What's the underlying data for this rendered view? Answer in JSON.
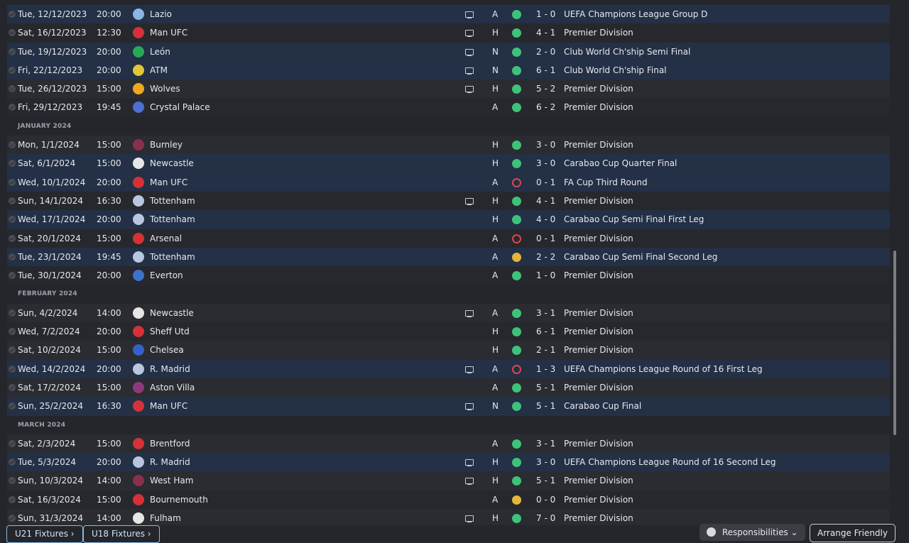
{
  "fixtures": [
    {
      "type": "fixture",
      "date": "Tue, 12/12/2023",
      "time": "20:00",
      "team": "Lazio",
      "tv": true,
      "venue": "A",
      "result": "W",
      "score": "1 - 0",
      "competition": "UEFA Champions League Group D",
      "cup": true,
      "badge_color": "#8ab6e6"
    },
    {
      "type": "fixture",
      "date": "Sat, 16/12/2023",
      "time": "12:30",
      "team": "Man UFC",
      "tv": true,
      "venue": "H",
      "result": "W",
      "score": "4 - 1",
      "competition": "Premier Division",
      "cup": false,
      "badge_color": "#d63139"
    },
    {
      "type": "fixture",
      "date": "Tue, 19/12/2023",
      "time": "20:00",
      "team": "León",
      "tv": true,
      "venue": "N",
      "result": "W",
      "score": "2 - 0",
      "competition": "Club World Ch'ship Semi Final",
      "cup": true,
      "badge_color": "#2aa85a"
    },
    {
      "type": "fixture",
      "date": "Fri, 22/12/2023",
      "time": "20:00",
      "team": "ATM",
      "tv": true,
      "venue": "N",
      "result": "W",
      "score": "6 - 1",
      "competition": "Club World Ch'ship Final",
      "cup": true,
      "badge_color": "#e3c53a"
    },
    {
      "type": "fixture",
      "date": "Tue, 26/12/2023",
      "time": "15:00",
      "team": "Wolves",
      "tv": true,
      "venue": "H",
      "result": "W",
      "score": "5 - 2",
      "competition": "Premier Division",
      "cup": false,
      "badge_color": "#f0a81f"
    },
    {
      "type": "fixture",
      "date": "Fri, 29/12/2023",
      "time": "19:45",
      "team": "Crystal Palace",
      "tv": false,
      "venue": "A",
      "result": "W",
      "score": "6 - 2",
      "competition": "Premier Division",
      "cup": false,
      "badge_color": "#4c6fd1"
    },
    {
      "type": "header",
      "label": "JANUARY 2024"
    },
    {
      "type": "fixture",
      "date": "Mon, 1/1/2024",
      "time": "15:00",
      "team": "Burnley",
      "tv": false,
      "venue": "H",
      "result": "W",
      "score": "3 - 0",
      "competition": "Premier Division",
      "cup": false,
      "badge_color": "#8a2f4e"
    },
    {
      "type": "fixture",
      "date": "Sat, 6/1/2024",
      "time": "15:00",
      "team": "Newcastle",
      "tv": false,
      "venue": "H",
      "result": "W",
      "score": "3 - 0",
      "competition": "Carabao Cup Quarter Final",
      "cup": true,
      "badge_color": "#e6e6e6"
    },
    {
      "type": "fixture",
      "date": "Wed, 10/1/2024",
      "time": "20:00",
      "team": "Man UFC",
      "tv": false,
      "venue": "A",
      "result": "L",
      "score": "0 - 1",
      "competition": "FA Cup Third Round",
      "cup": true,
      "badge_color": "#d63139"
    },
    {
      "type": "fixture",
      "date": "Sun, 14/1/2024",
      "time": "16:30",
      "team": "Tottenham",
      "tv": true,
      "venue": "H",
      "result": "W",
      "score": "4 - 1",
      "competition": "Premier Division",
      "cup": false,
      "badge_color": "#b8c6e0"
    },
    {
      "type": "fixture",
      "date": "Wed, 17/1/2024",
      "time": "20:00",
      "team": "Tottenham",
      "tv": false,
      "venue": "H",
      "result": "W",
      "score": "4 - 0",
      "competition": "Carabao Cup Semi Final First Leg",
      "cup": true,
      "badge_color": "#b8c6e0"
    },
    {
      "type": "fixture",
      "date": "Sat, 20/1/2024",
      "time": "15:00",
      "team": "Arsenal",
      "tv": false,
      "venue": "A",
      "result": "L",
      "score": "0 - 1",
      "competition": "Premier Division",
      "cup": false,
      "badge_color": "#d63139"
    },
    {
      "type": "fixture",
      "date": "Tue, 23/1/2024",
      "time": "19:45",
      "team": "Tottenham",
      "tv": false,
      "venue": "A",
      "result": "D",
      "score": "2 - 2",
      "competition": "Carabao Cup Semi Final Second Leg",
      "cup": true,
      "badge_color": "#b8c6e0"
    },
    {
      "type": "fixture",
      "date": "Tue, 30/1/2024",
      "time": "20:00",
      "team": "Everton",
      "tv": false,
      "venue": "A",
      "result": "W",
      "score": "1 - 0",
      "competition": "Premier Division",
      "cup": false,
      "badge_color": "#3b73c8"
    },
    {
      "type": "header",
      "label": "FEBRUARY 2024"
    },
    {
      "type": "fixture",
      "date": "Sun, 4/2/2024",
      "time": "14:00",
      "team": "Newcastle",
      "tv": true,
      "venue": "A",
      "result": "W",
      "score": "3 - 1",
      "competition": "Premier Division",
      "cup": false,
      "badge_color": "#e6e6e6"
    },
    {
      "type": "fixture",
      "date": "Wed, 7/2/2024",
      "time": "20:00",
      "team": "Sheff Utd",
      "tv": false,
      "venue": "H",
      "result": "W",
      "score": "6 - 1",
      "competition": "Premier Division",
      "cup": false,
      "badge_color": "#d63139"
    },
    {
      "type": "fixture",
      "date": "Sat, 10/2/2024",
      "time": "15:00",
      "team": "Chelsea",
      "tv": false,
      "venue": "H",
      "result": "W",
      "score": "2 - 1",
      "competition": "Premier Division",
      "cup": false,
      "badge_color": "#3560c9"
    },
    {
      "type": "fixture",
      "date": "Wed, 14/2/2024",
      "time": "20:00",
      "team": "R. Madrid",
      "tv": true,
      "venue": "A",
      "result": "L",
      "score": "1 - 3",
      "competition": "UEFA Champions League Round of 16  First Leg",
      "cup": true,
      "badge_color": "#b8c6e0"
    },
    {
      "type": "fixture",
      "date": "Sat, 17/2/2024",
      "time": "15:00",
      "team": "Aston Villa",
      "tv": false,
      "venue": "A",
      "result": "W",
      "score": "5 - 1",
      "competition": "Premier Division",
      "cup": false,
      "badge_color": "#8a3a7a"
    },
    {
      "type": "fixture",
      "date": "Sun, 25/2/2024",
      "time": "16:30",
      "team": "Man UFC",
      "tv": true,
      "venue": "N",
      "result": "W",
      "score": "5 - 1",
      "competition": "Carabao Cup Final",
      "cup": true,
      "badge_color": "#d63139"
    },
    {
      "type": "header",
      "label": "MARCH 2024"
    },
    {
      "type": "fixture",
      "date": "Sat, 2/3/2024",
      "time": "15:00",
      "team": "Brentford",
      "tv": false,
      "venue": "A",
      "result": "W",
      "score": "3 - 1",
      "competition": "Premier Division",
      "cup": false,
      "badge_color": "#d63139"
    },
    {
      "type": "fixture",
      "date": "Tue, 5/3/2024",
      "time": "20:00",
      "team": "R. Madrid",
      "tv": true,
      "venue": "H",
      "result": "W",
      "score": "3 - 0",
      "competition": "UEFA Champions League Round of 16  Second Leg",
      "cup": true,
      "badge_color": "#b8c6e0"
    },
    {
      "type": "fixture",
      "date": "Sun, 10/3/2024",
      "time": "14:00",
      "team": "West Ham",
      "tv": true,
      "venue": "H",
      "result": "W",
      "score": "5 - 1",
      "competition": "Premier Division",
      "cup": false,
      "badge_color": "#8a2f4e"
    },
    {
      "type": "fixture",
      "date": "Sat, 16/3/2024",
      "time": "15:00",
      "team": "Bournemouth",
      "tv": false,
      "venue": "A",
      "result": "D",
      "score": "0 - 0",
      "competition": "Premier Division",
      "cup": false,
      "badge_color": "#d63139"
    },
    {
      "type": "fixture",
      "date": "Sun, 31/3/2024",
      "time": "14:00",
      "team": "Fulham",
      "tv": true,
      "venue": "H",
      "result": "W",
      "score": "7 - 0",
      "competition": "Premier Division",
      "cup": false,
      "badge_color": "#e6e6e6"
    }
  ],
  "bottom_bar": {
    "u21_label": "U21 Fixtures",
    "u18_label": "U18 Fixtures",
    "responsibilities_label": "Responsibilities",
    "arrange_friendly_label": "Arrange Friendly"
  },
  "colors": {
    "win": "#3ec27a",
    "loss": "#e0454b",
    "draw": "#e6b43a",
    "accent": "#8db7e6"
  }
}
